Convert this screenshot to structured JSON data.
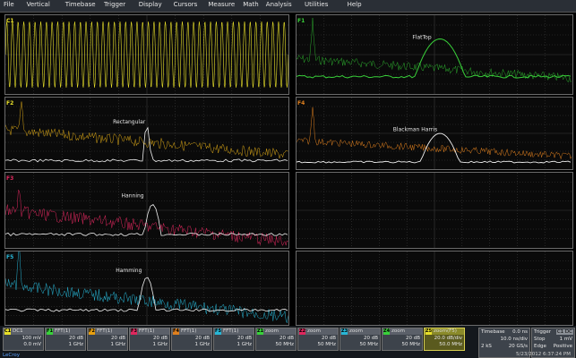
{
  "menu": [
    "File",
    "Vertical",
    "Timebase",
    "Trigger",
    "Display",
    "Cursors",
    "Measure",
    "Math",
    "Analysis",
    "Utilities",
    "Help"
  ],
  "colors": {
    "yellow": "#e8e02a",
    "green": "#39d13a",
    "orange": "#e0801e",
    "pink": "#e0285e",
    "cyan": "#28b6d6",
    "white": "#f0f0f0"
  },
  "panels": [
    {
      "id": "C1",
      "label": "C1",
      "color": "#e8e02a"
    },
    {
      "id": "F1",
      "label": "F1",
      "color": "#39d13a",
      "annotation": "FlatTop"
    },
    {
      "id": "F2",
      "label": "F2",
      "color": "#e8a010",
      "annotation": "Rectangular"
    },
    {
      "id": "F4",
      "label": "F4",
      "color": "#e0801e",
      "annotation": "Blackman Harris"
    },
    {
      "id": "F3",
      "label": "F3",
      "color": "#e0285e",
      "annotation": "Hanning"
    },
    {
      "id": "F5",
      "label": "F5",
      "color": "#28b6d6",
      "annotation": "Hamming"
    }
  ],
  "channels": [
    {
      "num": "C1",
      "name": "DC1",
      "v1": "100 mV",
      "v2": "0.0 mV",
      "color": "#e8e02a"
    },
    {
      "num": "F1",
      "name": "FFT(1)",
      "v1": "20 dB",
      "v2": "1 GHz",
      "color": "#39d13a"
    },
    {
      "num": "F2",
      "name": "FFT(1)",
      "v1": "20 dB",
      "v2": "1 GHz",
      "color": "#e8a010"
    },
    {
      "num": "F3",
      "name": "FFT(1)",
      "v1": "20 dB",
      "v2": "1 GHz",
      "color": "#e0285e"
    },
    {
      "num": "F4",
      "name": "FFT(1)",
      "v1": "20 dB",
      "v2": "1 GHz",
      "color": "#e0801e"
    },
    {
      "num": "F5",
      "name": "FFT(1)",
      "v1": "20 dB",
      "v2": "1 GHz",
      "color": "#28b6d6"
    },
    {
      "num": "Z1",
      "name": "zoom",
      "v1": "20 dB",
      "v2": "50 MHz",
      "color": "#39d13a"
    },
    {
      "num": "Z2",
      "name": "zoom",
      "v1": "20 dB",
      "v2": "50 MHz",
      "color": "#e0285e"
    },
    {
      "num": "Z3",
      "name": "zoom",
      "v1": "20 dB",
      "v2": "50 MHz",
      "color": "#28b6d6"
    },
    {
      "num": "Z4",
      "name": "zoom",
      "v1": "20 dB",
      "v2": "50 MHz",
      "color": "#39d13a"
    },
    {
      "num": "Z5",
      "name": "zoom(F5)",
      "v1": "20.0 dB/div",
      "v2": "50.0 MHz",
      "color": "#e8e02a",
      "highlight": true
    }
  ],
  "timebase": {
    "title": "Timebase",
    "offset": "0.0 ns",
    "div": "10.0 ns/div",
    "samples": "2 kS",
    "rate": "20 GS/s"
  },
  "trigger": {
    "title": "Trigger",
    "channel": "C1 DC",
    "mode": "Stop",
    "level": "1 mV",
    "type": "Edge",
    "slope": "Positive"
  },
  "datetime": "5/23/2012 6:37:24 PM",
  "brand": "LeCroy"
}
